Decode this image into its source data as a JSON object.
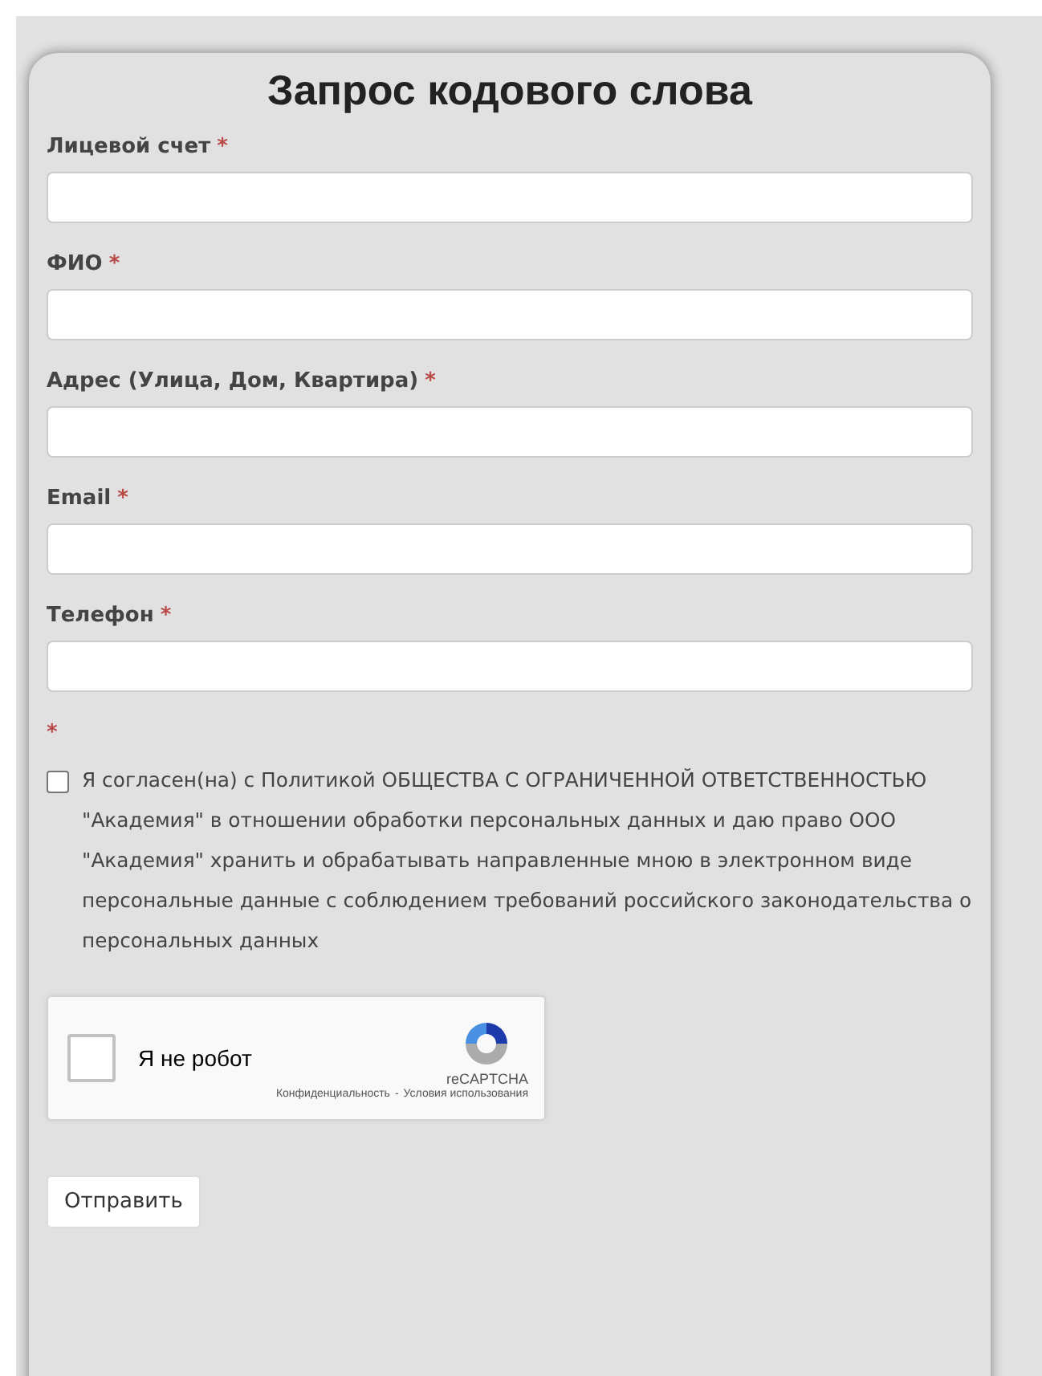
{
  "title": "Запрос кодового слова",
  "fields": [
    {
      "label": "Лицевой счет",
      "required_mark": "*"
    },
    {
      "label": "ФИО",
      "required_mark": "*"
    },
    {
      "label": "Адрес (Улица, Дом, Квартира)",
      "required_mark": "*"
    },
    {
      "label": "Email",
      "required_mark": "*"
    },
    {
      "label": "Телефон",
      "required_mark": "*"
    }
  ],
  "consent": {
    "required_mark": "*",
    "checked": false,
    "text": "Я согласен(на) с Политикой ОБЩЕСТВА С ОГРАНИЧЕННОЙ ОТВЕТСТВЕННОСТЬЮ \"Академия\" в отношении обработки персональных данных и даю право ООО \"Академия\" хранить и обрабатывать направленные мною в электронном виде персональные данные с соблюдением требований российского законодательства о персональных данных"
  },
  "captcha": {
    "checked": false,
    "label": "Я не робот",
    "brand": "reCAPTCHA",
    "privacy_link": "Конфиденциальность",
    "separator": "-",
    "terms_link": "Условия использования"
  },
  "submit_button": "Отправить"
}
